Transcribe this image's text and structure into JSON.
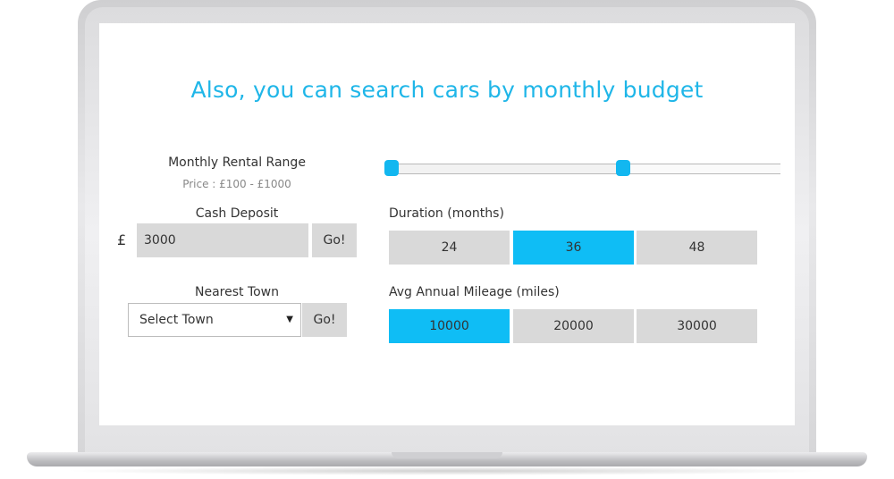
{
  "headline": "Also, you can search cars by monthly budget",
  "monthly_range": {
    "label": "Monthly Rental Range",
    "price_text": "Price : £100 - £1000",
    "slider_low_fraction": 0.0,
    "slider_high_fraction": 0.6
  },
  "cash_deposit": {
    "label": "Cash Deposit",
    "currency": "£",
    "value": "3000",
    "go_label": "Go!"
  },
  "nearest_town": {
    "label": "Nearest Town",
    "selected": "Select Town",
    "go_label": "Go!"
  },
  "duration": {
    "label": "Duration (months)",
    "options": [
      "24",
      "36",
      "48"
    ],
    "selected": "36"
  },
  "mileage": {
    "label": "Avg Annual Mileage (miles)",
    "options": [
      "10000",
      "20000",
      "30000"
    ],
    "selected": "10000"
  },
  "colors": {
    "accent": "#0fbdf5",
    "headline": "#1fb6e8",
    "button_bg": "#d9d9d9"
  }
}
